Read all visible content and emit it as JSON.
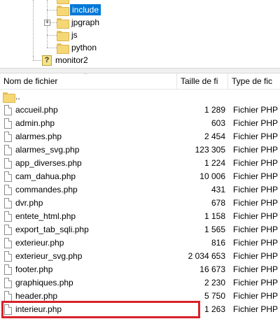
{
  "tree": {
    "nodes": [
      {
        "label": "include",
        "selected": true
      },
      {
        "label": "jpgraph"
      },
      {
        "label": "js"
      },
      {
        "label": "python"
      },
      {
        "label": "monitor2"
      }
    ]
  },
  "list": {
    "columns": [
      "Nom de fichier",
      "Taille de fi",
      "Type de fic"
    ],
    "parent_dir": "..",
    "files": [
      {
        "name": "accueil.php",
        "size": "1 289",
        "type": "Fichier PHP"
      },
      {
        "name": "admin.php",
        "size": "603",
        "type": "Fichier PHP"
      },
      {
        "name": "alarmes.php",
        "size": "2 454",
        "type": "Fichier PHP"
      },
      {
        "name": "alarmes_svg.php",
        "size": "123 305",
        "type": "Fichier PHP"
      },
      {
        "name": "app_diverses.php",
        "size": "1 224",
        "type": "Fichier PHP"
      },
      {
        "name": "cam_dahua.php",
        "size": "10 006",
        "type": "Fichier PHP"
      },
      {
        "name": "commandes.php",
        "size": "431",
        "type": "Fichier PHP"
      },
      {
        "name": "dvr.php",
        "size": "678",
        "type": "Fichier PHP"
      },
      {
        "name": "entete_html.php",
        "size": "1 158",
        "type": "Fichier PHP"
      },
      {
        "name": "export_tab_sqli.php",
        "size": "1 565",
        "type": "Fichier PHP"
      },
      {
        "name": "exterieur.php",
        "size": "816",
        "type": "Fichier PHP"
      },
      {
        "name": "exterieur_svg.php",
        "size": "2 034 653",
        "type": "Fichier PHP"
      },
      {
        "name": "footer.php",
        "size": "16 673",
        "type": "Fichier PHP"
      },
      {
        "name": "graphiques.php",
        "size": "2 230",
        "type": "Fichier PHP"
      },
      {
        "name": "header.php",
        "size": "5 750",
        "type": "Fichier PHP"
      },
      {
        "name": "interieur.php",
        "size": "1 263",
        "type": "Fichier PHP"
      }
    ]
  },
  "colors": {
    "selection": "#0078d7",
    "highlight_border": "#d8232a",
    "folder": "#f6d775"
  }
}
